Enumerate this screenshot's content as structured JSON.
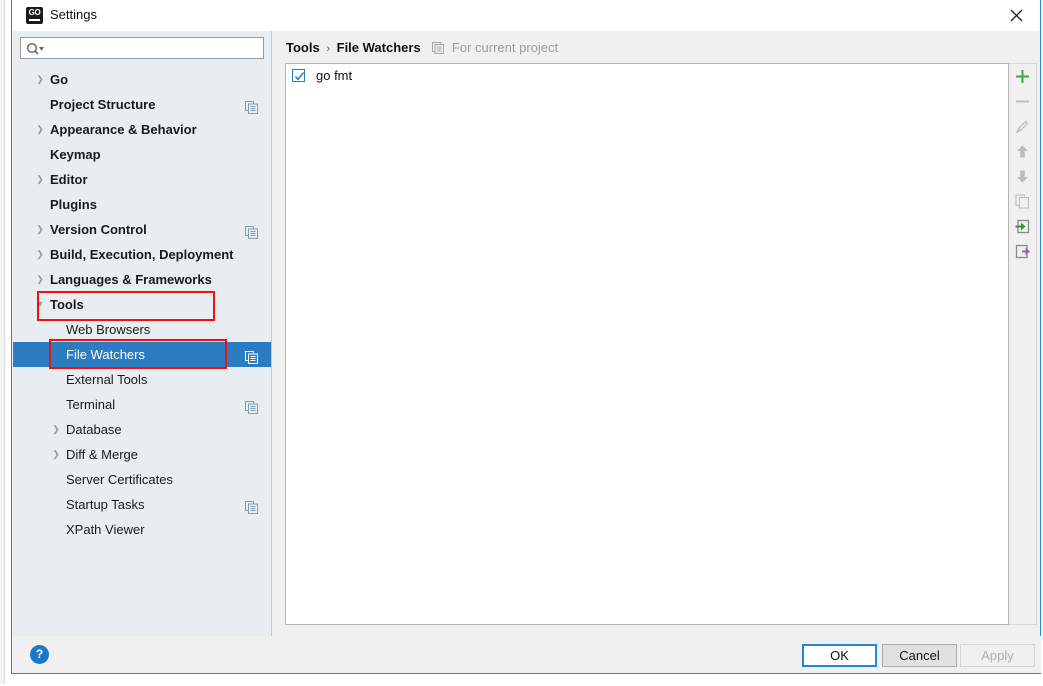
{
  "window": {
    "title": "Settings",
    "app_icon": "go-logo-icon",
    "close_icon": "close-icon",
    "accent_color": "#1f8ad2"
  },
  "search": {
    "placeholder": "",
    "value": "",
    "icon": "search-icon",
    "dropdown_icon": "chevron-down-icon"
  },
  "sidebar": {
    "items": [
      {
        "label": "Go",
        "level": 0,
        "chevron": "collapsed",
        "badge": false,
        "selected": false
      },
      {
        "label": "Project Structure",
        "level": 0,
        "chevron": "none",
        "badge": true,
        "selected": false
      },
      {
        "label": "Appearance & Behavior",
        "level": 0,
        "chevron": "collapsed",
        "badge": false,
        "selected": false
      },
      {
        "label": "Keymap",
        "level": 0,
        "chevron": "none",
        "badge": false,
        "selected": false
      },
      {
        "label": "Editor",
        "level": 0,
        "chevron": "collapsed",
        "badge": false,
        "selected": false
      },
      {
        "label": "Plugins",
        "level": 0,
        "chevron": "none",
        "badge": false,
        "selected": false
      },
      {
        "label": "Version Control",
        "level": 0,
        "chevron": "collapsed",
        "badge": true,
        "selected": false
      },
      {
        "label": "Build, Execution, Deployment",
        "level": 0,
        "chevron": "collapsed",
        "badge": false,
        "selected": false
      },
      {
        "label": "Languages & Frameworks",
        "level": 0,
        "chevron": "collapsed",
        "badge": false,
        "selected": false
      },
      {
        "label": "Tools",
        "level": 0,
        "chevron": "expanded",
        "badge": false,
        "selected": false
      },
      {
        "label": "Web Browsers",
        "level": 1,
        "chevron": "none",
        "badge": false,
        "selected": false
      },
      {
        "label": "File Watchers",
        "level": 1,
        "chevron": "none",
        "badge": true,
        "selected": true
      },
      {
        "label": "External Tools",
        "level": 1,
        "chevron": "none",
        "badge": false,
        "selected": false
      },
      {
        "label": "Terminal",
        "level": 1,
        "chevron": "none",
        "badge": true,
        "selected": false
      },
      {
        "label": "Database",
        "level": 1,
        "chevron": "collapsed",
        "badge": false,
        "selected": false
      },
      {
        "label": "Diff & Merge",
        "level": 1,
        "chevron": "collapsed",
        "badge": false,
        "selected": false
      },
      {
        "label": "Server Certificates",
        "level": 1,
        "chevron": "none",
        "badge": false,
        "selected": false
      },
      {
        "label": "Startup Tasks",
        "level": 1,
        "chevron": "none",
        "badge": true,
        "selected": false
      },
      {
        "label": "XPath Viewer",
        "level": 1,
        "chevron": "none",
        "badge": false,
        "selected": false
      }
    ],
    "selection_color": "#2b7cc0",
    "background_color": "#e7edf1"
  },
  "breadcrumb": {
    "parent": "Tools",
    "separator": "›",
    "current": "File Watchers",
    "scope_icon": "project-scope-icon",
    "scope_label": "For current project"
  },
  "watchers": {
    "rows": [
      {
        "label": "go fmt",
        "checked": true
      }
    ]
  },
  "toolbar": {
    "buttons": [
      {
        "name": "add-button",
        "icon": "plus-icon",
        "enabled": true
      },
      {
        "name": "remove-button",
        "icon": "minus-icon",
        "enabled": false
      },
      {
        "name": "edit-button",
        "icon": "pencil-icon",
        "enabled": false
      },
      {
        "name": "move-up-button",
        "icon": "arrow-up-icon",
        "enabled": false
      },
      {
        "name": "move-down-button",
        "icon": "arrow-down-icon",
        "enabled": false
      },
      {
        "name": "copy-button",
        "icon": "copy-icon",
        "enabled": false
      },
      {
        "name": "import-button",
        "icon": "import-icon",
        "enabled": true
      },
      {
        "name": "export-button",
        "icon": "export-icon",
        "enabled": true
      }
    ]
  },
  "footer": {
    "help_label": "?",
    "ok_label": "OK",
    "cancel_label": "Cancel",
    "apply_label": "Apply",
    "apply_enabled": false
  },
  "annotations": [
    {
      "name": "annotation-tools",
      "color": "#ee1111"
    },
    {
      "name": "annotation-file-watchers",
      "color": "#ee1111"
    }
  ]
}
